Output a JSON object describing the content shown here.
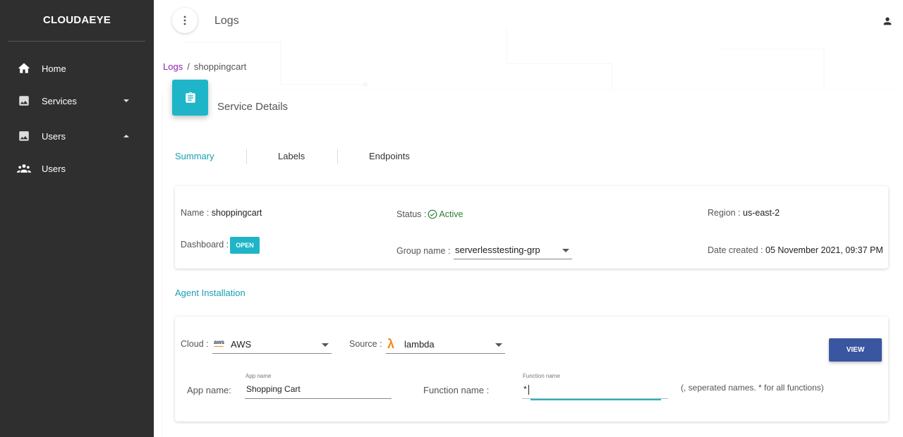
{
  "sidebar": {
    "brand": "CLOUDAEYE",
    "items": [
      {
        "label": "Home",
        "icon": "home-icon"
      },
      {
        "label": "Services",
        "icon": "image-icon",
        "caret": "down"
      },
      {
        "label": "Users",
        "icon": "image-icon",
        "caret": "up"
      },
      {
        "label": "Users",
        "icon": "users-group-icon"
      }
    ]
  },
  "header": {
    "title": "Logs"
  },
  "breadcrumb": {
    "link": "Logs",
    "separator": "/",
    "current": "shoppingcart"
  },
  "card": {
    "title": "Service Details"
  },
  "tabs": [
    {
      "label": "Summary",
      "active": true
    },
    {
      "label": "Labels",
      "active": false
    },
    {
      "label": "Endpoints",
      "active": false
    }
  ],
  "summary": {
    "name_label": "Name : ",
    "name_value": "shoppingcart",
    "status_label": "Status : ",
    "status_value": "Active",
    "region_label": "Region : ",
    "region_value": "us-east-2",
    "dashboard_label": "Dashboard : ",
    "open_label": "OPEN",
    "group_label": "Group name : ",
    "group_value": "serverlesstesting-grp",
    "date_label": "Date created : ",
    "date_value": "05 November 2021, 09:37 PM"
  },
  "agent": {
    "section_title": "Agent Installation",
    "cloud_label": "Cloud : ",
    "cloud_value": "AWS",
    "cloud_icon_text": "aws",
    "source_label": "Source : ",
    "source_value": "lambda",
    "view_label": "VIEW",
    "app_name_label": "App name:",
    "app_name_small": "App name",
    "app_name_value": "Shopping Cart",
    "function_name_label": "Function name :",
    "function_name_small": "Function name",
    "function_name_value": "*",
    "hint": "(, seperated names. * for all functions)"
  },
  "colors": {
    "accent": "#1fb5c8",
    "primary_button": "#3a56a0",
    "sidebar": "#2f2f2f",
    "breadcrumb_link": "#8e24aa",
    "status_active": "#2e7d32",
    "lambda_orange": "#f5871f"
  }
}
